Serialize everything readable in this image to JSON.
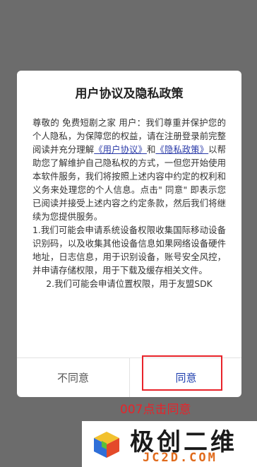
{
  "dialog": {
    "title": "用户协议及隐私政策",
    "intro_1": "尊敬的 免费短剧之家 用户：我们尊重并保护您的个人隐私，为保障您的权益，请在注册登录前完整阅读并充分理解",
    "user_agreement_link": "《用户协议》",
    "and_text": "和",
    "privacy_policy_link": "《隐私政策》",
    "intro_2": "以帮助您了解维护自己隐私权的方式，一但您开始使用本软件服务，我们将按照上述内容中约定的权利和义务来处理您的个人信息。点击\" 同意\" 即表示您已阅读并接受上述内容之约定条款，然后我们将继续为您提供服务。",
    "item_1": "1.我们可能会申请系统设备权限收集国际移动设备识别码，以及收集其他设备信息如果网络设备硬件地址，日志信息，用于识别设备，账号安全风控，并申请存储权限，用于下载及缓存相关文件。",
    "item_2": "2.我们可能会申请位置权限，用于友盟SDK",
    "disagree_label": "不同意",
    "agree_label": "同意"
  },
  "annotation": {
    "text": "007点击同意",
    "color": "#e8232a"
  },
  "watermark": {
    "title": "极创二维",
    "subtitle": "JC2D.COM"
  },
  "colors": {
    "link": "#2a3aa8",
    "agree": "#1f3fae",
    "backdrop": "#6c6c6c"
  }
}
